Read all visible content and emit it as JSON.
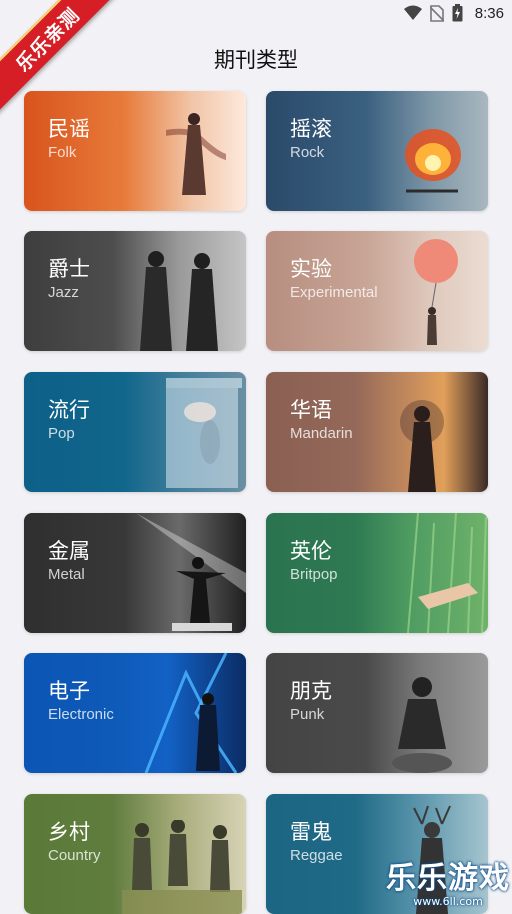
{
  "status": {
    "time": "8:36"
  },
  "ribbon": {
    "text": "乐乐亲测"
  },
  "page": {
    "title": "期刊类型"
  },
  "categories": [
    {
      "name": "民谣",
      "en": "Folk"
    },
    {
      "name": "摇滚",
      "en": "Rock"
    },
    {
      "name": "爵士",
      "en": "Jazz"
    },
    {
      "name": "实验",
      "en": "Experimental"
    },
    {
      "name": "流行",
      "en": "Pop"
    },
    {
      "name": "华语",
      "en": "Mandarin"
    },
    {
      "name": "金属",
      "en": "Metal"
    },
    {
      "name": "英伦",
      "en": "Britpop"
    },
    {
      "name": "电子",
      "en": "Electronic"
    },
    {
      "name": "朋克",
      "en": "Punk"
    },
    {
      "name": "乡村",
      "en": "Country"
    },
    {
      "name": "雷鬼",
      "en": "Reggae"
    }
  ],
  "watermark": {
    "title": "乐乐游戏",
    "url": "www.6ll.com"
  },
  "colors": {
    "folk": "#e06a2a",
    "rock": "#2f5577",
    "jazz": "#444444",
    "experimental": "#c9a79c",
    "pop": "#11668b",
    "mandarin": "#8c6456",
    "metal": "#3a3a3a",
    "britpop": "#2e7a52",
    "electronic": "#0e5ab8",
    "punk": "#4a4a4a",
    "country": "#5b7a3a",
    "reggae": "#1f6a86"
  }
}
